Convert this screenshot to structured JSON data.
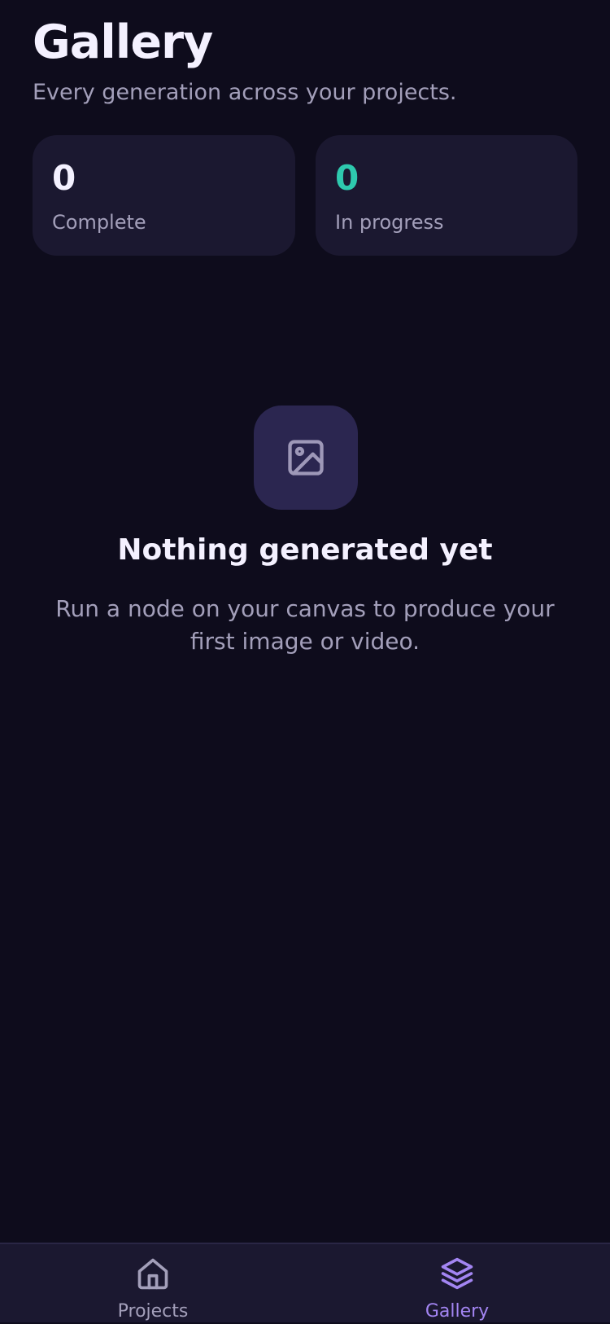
{
  "header": {
    "title": "Gallery",
    "subtitle": "Every generation across your projects."
  },
  "stats": [
    {
      "value": "0",
      "label": "Complete",
      "color": "#f4f1ff"
    },
    {
      "value": "0",
      "label": "In progress",
      "color": "#2ec9ae"
    }
  ],
  "empty_state": {
    "icon": "image-icon",
    "title": "Nothing generated yet",
    "description": "Run a node on your canvas to produce your first image or video."
  },
  "bottom_nav": {
    "items": [
      {
        "label": "Projects",
        "icon": "home-icon",
        "active": false
      },
      {
        "label": "Gallery",
        "icon": "layers-icon",
        "active": true
      }
    ],
    "active_color": "#a385f2"
  }
}
